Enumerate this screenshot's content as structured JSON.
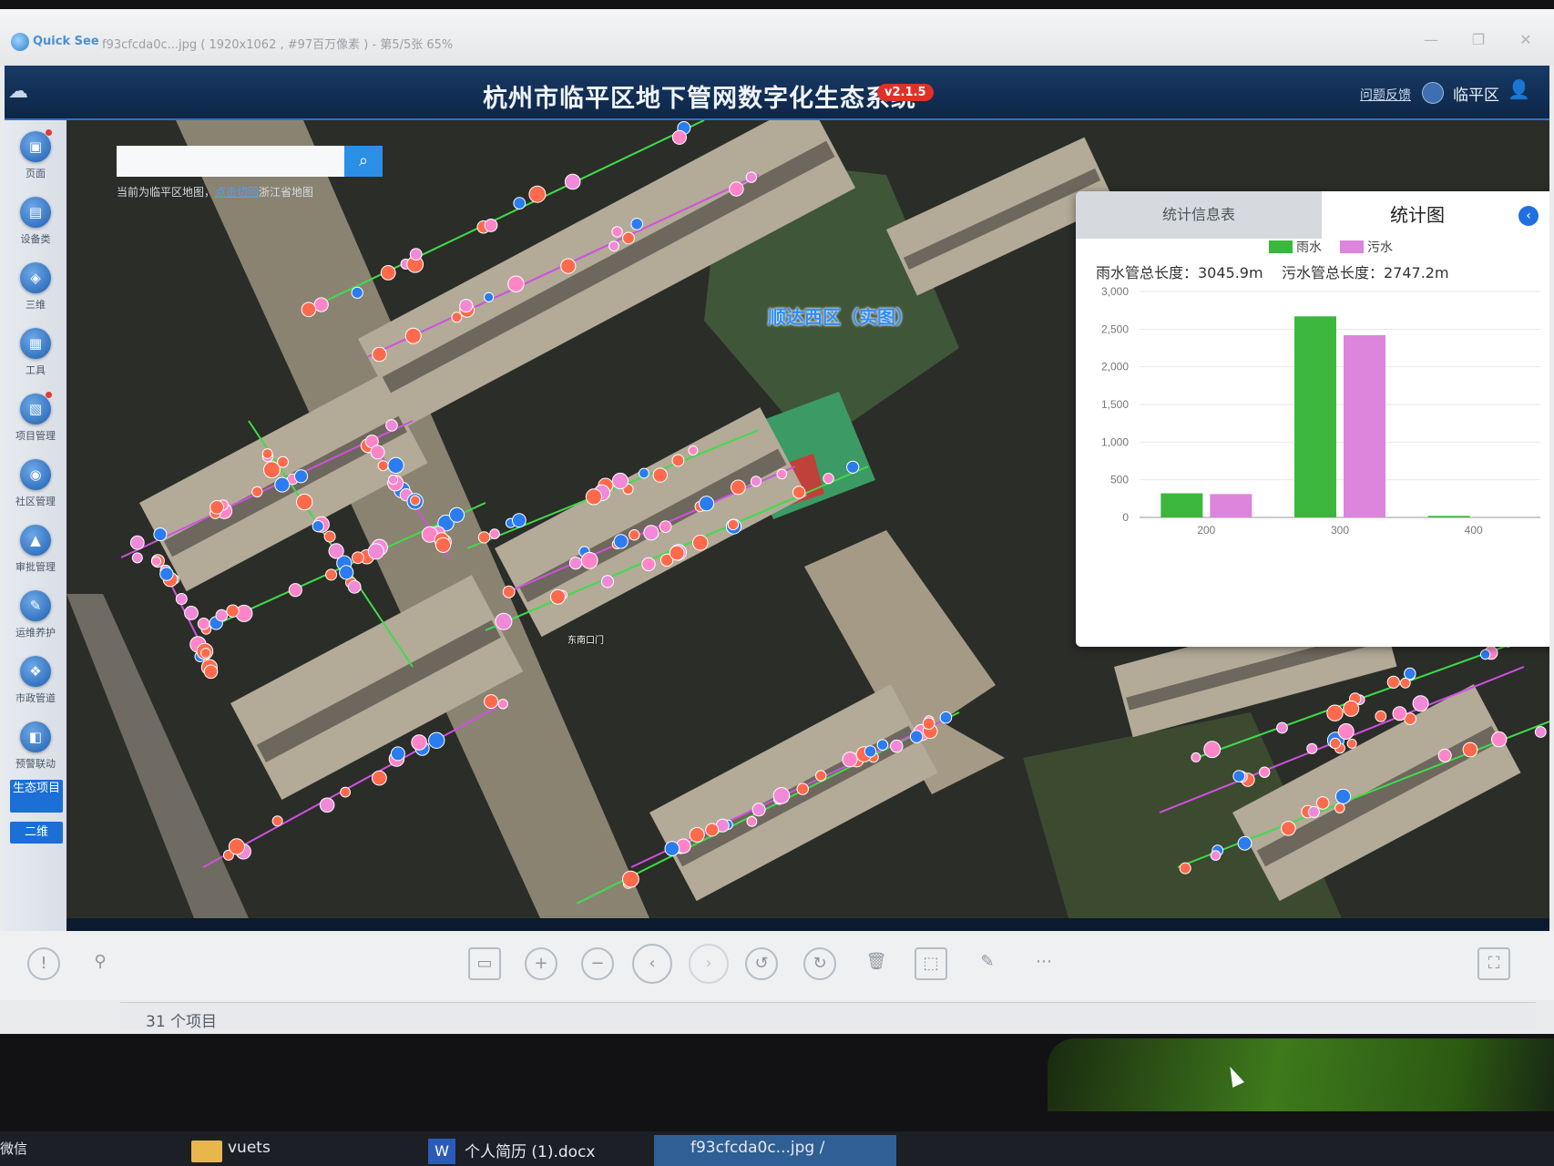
{
  "viewer": {
    "app_name": "Quick See",
    "file_info": "f93cfcda0c...jpg ( 1920x1062 , #97百万像素 ) - 第5/5张 65%",
    "status_count": "31 个项目"
  },
  "app": {
    "title": "杭州市临平区地下管网数字化生态系统",
    "version": "v2.1.5",
    "feedback": "问题反馈",
    "district": "临平区"
  },
  "sidebar": {
    "items": [
      {
        "label": "页面",
        "icon": "page-icon"
      },
      {
        "label": "设备类",
        "icon": "device-icon"
      },
      {
        "label": "三维",
        "icon": "3d-icon"
      },
      {
        "label": "工具",
        "icon": "tool-icon"
      },
      {
        "label": "项目管理",
        "icon": "project-icon"
      },
      {
        "label": "社区管理",
        "icon": "community-icon"
      },
      {
        "label": "审批管理",
        "icon": "approval-icon"
      },
      {
        "label": "运维养护",
        "icon": "maintenance-icon"
      },
      {
        "label": "市政管道",
        "icon": "pipe-icon"
      },
      {
        "label": "预警联动",
        "icon": "alert-icon"
      }
    ],
    "eco_button": "生态项目",
    "view_button": "二维"
  },
  "map": {
    "search_placeholder": "",
    "hint_prefix": "当前为临平区地图，",
    "hint_link": "点击切回",
    "hint_suffix": "浙江省地图",
    "district_label": "顺达西区（实图）",
    "gate_label": "东南口门",
    "watermark": "临平区"
  },
  "stats": {
    "tab_info": "统计信息表",
    "tab_chart": "统计图",
    "rain_total": "雨水管总长度：3045.9m",
    "sewage_total": "污水管总长度：2747.2m"
  },
  "chart_data": {
    "type": "bar",
    "categories": [
      "200",
      "300",
      "400"
    ],
    "series": [
      {
        "name": "雨水",
        "color": "#3cb73c",
        "values": [
          320,
          2670,
          20
        ]
      },
      {
        "name": "污水",
        "color": "#dd84dd",
        "values": [
          310,
          2420,
          0
        ]
      }
    ],
    "ylim": [
      0,
      3000
    ],
    "yticks": [
      "0",
      "500",
      "1,000",
      "1,500",
      "2,000",
      "2,500",
      "3,000"
    ],
    "legend": "top-left",
    "grid": true
  },
  "taskbar": {
    "wechat": "微信",
    "folder": "vuets",
    "word_doc": "个人简历 (1).docx",
    "active_file": "f93cfcda0c...jpg /"
  }
}
